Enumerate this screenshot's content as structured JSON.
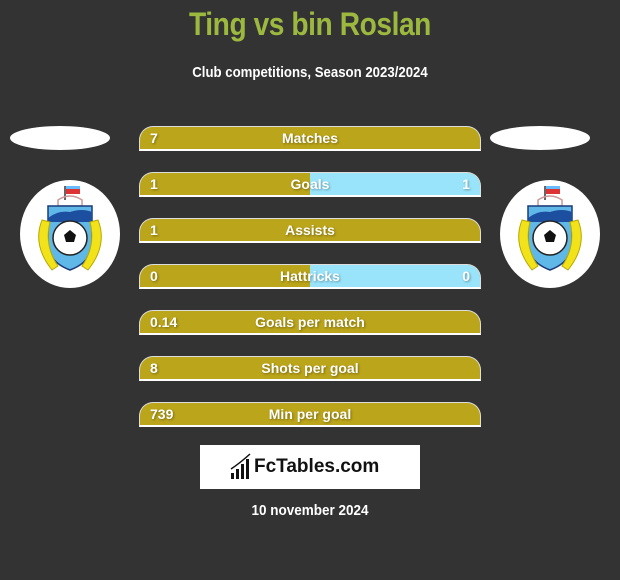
{
  "header": {
    "title": "Ting vs bin Roslan",
    "subtitle": "Club competitions, Season 2023/2024"
  },
  "players": {
    "left": {
      "name": "Ting",
      "club_logo": "sabah-fa-crest"
    },
    "right": {
      "name": "bin Roslan",
      "club_logo": "sabah-fa-crest"
    }
  },
  "colors": {
    "left_bar": "#bba51a",
    "right_bar": "#99e4fb",
    "title": "#9cb83f",
    "background": "#333333"
  },
  "stats": [
    {
      "label": "Matches",
      "left": "7",
      "right": "",
      "right_share": 0
    },
    {
      "label": "Goals",
      "left": "1",
      "right": "1",
      "right_share": 0.5
    },
    {
      "label": "Assists",
      "left": "1",
      "right": "",
      "right_share": 0
    },
    {
      "label": "Hattricks",
      "left": "0",
      "right": "0",
      "right_share": 0.5
    },
    {
      "label": "Goals per match",
      "left": "0.14",
      "right": "",
      "right_share": 0
    },
    {
      "label": "Shots per goal",
      "left": "8",
      "right": "",
      "right_share": 0
    },
    {
      "label": "Min per goal",
      "left": "739",
      "right": "",
      "right_share": 0
    }
  ],
  "footer": {
    "brand": "FcTables.com",
    "date": "10 november 2024"
  }
}
